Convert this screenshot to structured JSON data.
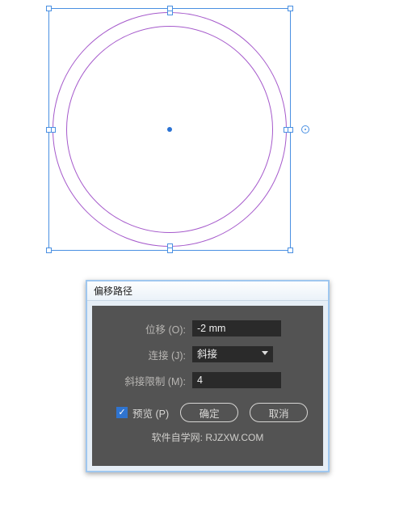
{
  "canvas": {
    "stroke_color": "#a050c8",
    "selection_color": "#4a90e2"
  },
  "dialog": {
    "title": "偏移路径",
    "rows": {
      "offset_label": "位移 (O):",
      "offset_value": "-2 mm",
      "joins_label": "连接 (J):",
      "joins_value": "斜接",
      "miter_label": "斜接限制 (M):",
      "miter_value": "4"
    },
    "preview_label": "预览 (P)",
    "preview_checked": true,
    "ok_label": "确定",
    "cancel_label": "取消",
    "footer_left": "软件自学网:",
    "footer_right": "RJZXW.COM"
  }
}
